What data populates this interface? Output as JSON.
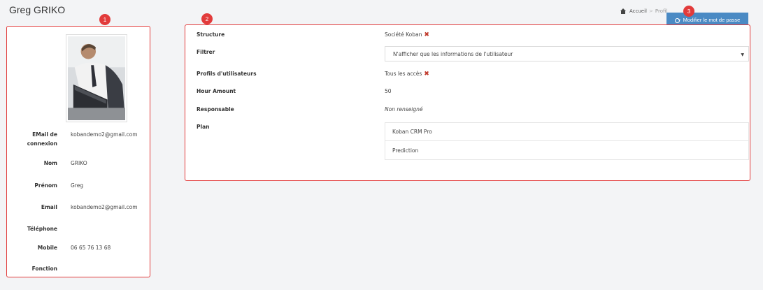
{
  "header": {
    "title": "Greg GRIKO",
    "breadcrumb": {
      "home": "Accueil",
      "separator": ">",
      "current": "Profil"
    },
    "edit_password_button": "Modifier le mot de passe"
  },
  "badges": [
    "1",
    "2",
    "3"
  ],
  "profile": {
    "fields": [
      {
        "label": "EMail de connexion",
        "value": "kobandemo2@gmail.com"
      },
      {
        "label": "Nom",
        "value": "GRIKO"
      },
      {
        "label": "Prénom",
        "value": "Greg"
      },
      {
        "label": "Email",
        "value": "kobandemo2@gmail.com"
      },
      {
        "label": "Téléphone",
        "value": ""
      },
      {
        "label": "Mobile",
        "value": "06 65 76 13 68"
      },
      {
        "label": "Fonction",
        "value": ""
      }
    ]
  },
  "details": {
    "structure": {
      "label": "Structure",
      "value": "Société Koban"
    },
    "filtrer": {
      "label": "Filtrer",
      "selected": "N'afficher que les informations de l'utilisateur"
    },
    "profils": {
      "label": "Profils d'utilisateurs",
      "value": "Tous les accès"
    },
    "hour_amount": {
      "label": "Hour Amount",
      "value": "50"
    },
    "responsable": {
      "label": "Responsable",
      "value": "Non renseigné"
    },
    "plan": {
      "label": "Plan",
      "items": [
        "Koban CRM Pro",
        "Prediction"
      ]
    }
  },
  "colors": {
    "accent": "#4a8ac4",
    "annotation": "#e23b3b"
  }
}
